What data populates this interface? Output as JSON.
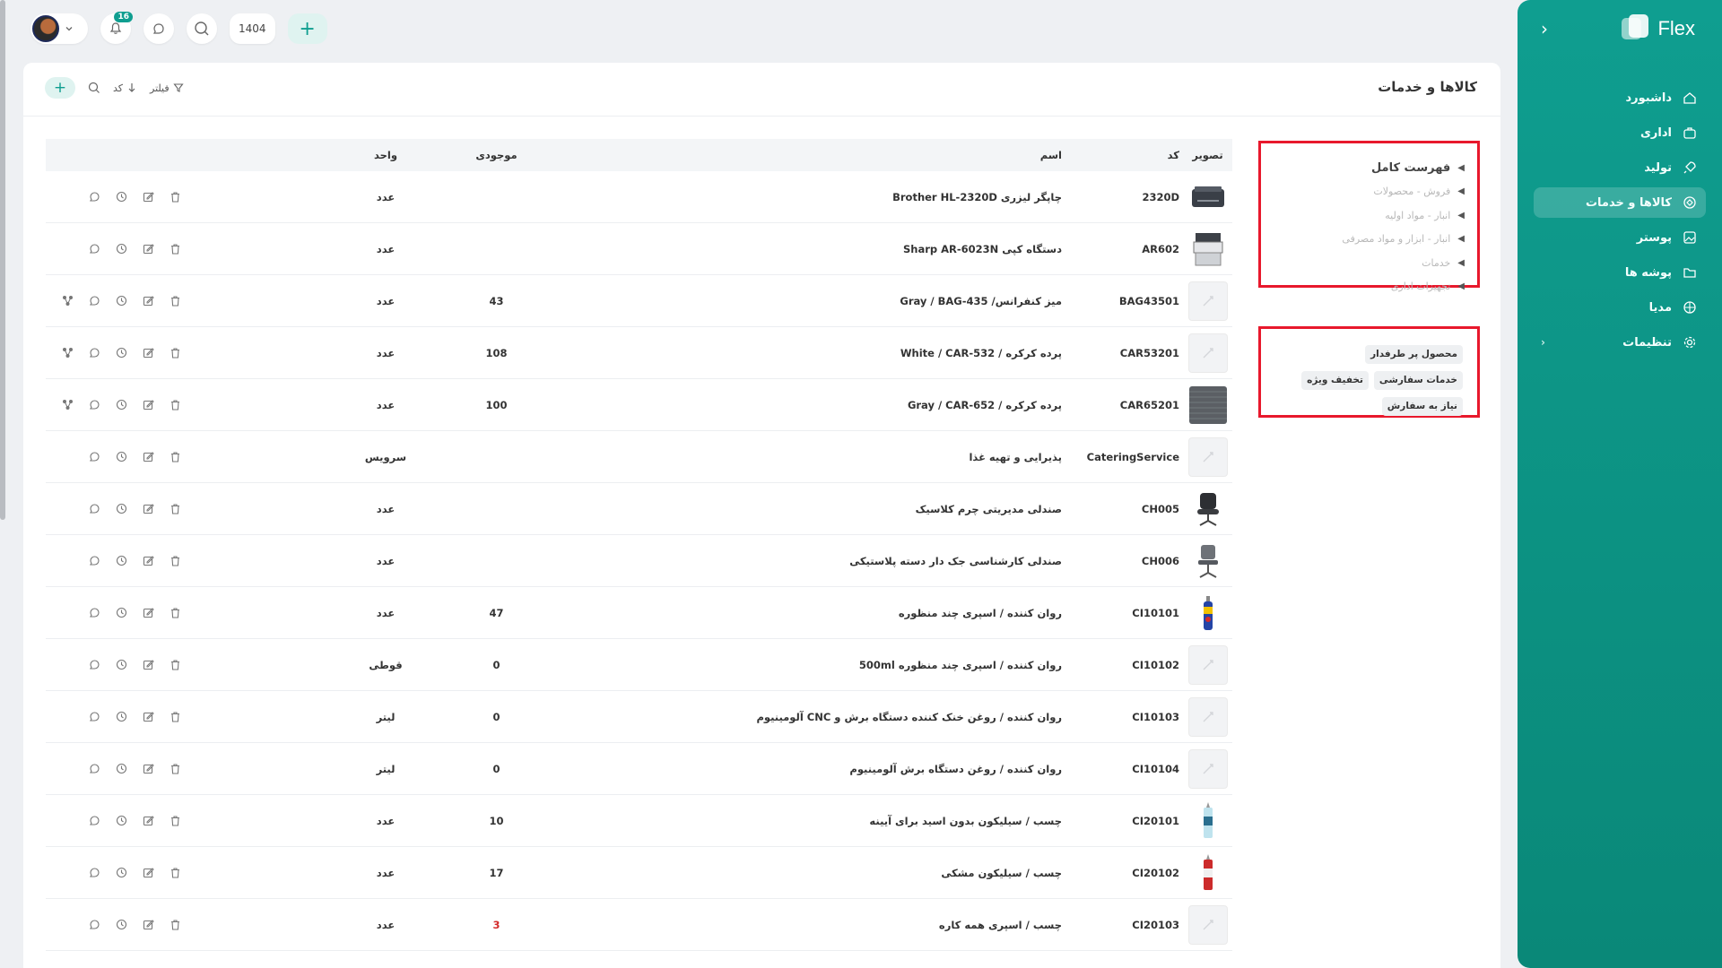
{
  "brand": {
    "name": "Flex"
  },
  "topbar": {
    "notifications_count": "16",
    "year": "1404"
  },
  "sidebar": {
    "items": [
      {
        "label": "داشبورد",
        "icon": "home-icon",
        "active": false
      },
      {
        "label": "اداری",
        "icon": "briefcase-icon",
        "active": false
      },
      {
        "label": "تولید",
        "icon": "rocket-icon",
        "active": false
      },
      {
        "label": "کالاها و خدمات",
        "icon": "box-icon",
        "active": true
      },
      {
        "label": "پوستر",
        "icon": "image-icon",
        "active": false
      },
      {
        "label": "پوشه ها",
        "icon": "folder-icon",
        "active": false
      },
      {
        "label": "مدیا",
        "icon": "media-icon",
        "active": false
      },
      {
        "label": "تنظیمات",
        "icon": "gear-icon",
        "active": false
      }
    ]
  },
  "page": {
    "title": "کالاها و خدمات",
    "tools": {
      "filter": "فیلتر",
      "sort": "کد"
    }
  },
  "categories": [
    "فهرست کامل",
    "فروش - محصولات",
    "انبار - مواد اولیه",
    "انبار - ابزار و مواد مصرفی",
    "خدمات",
    "تجهیزات اداری"
  ],
  "tags": [
    "محصول پر طرفدار",
    "خدمات سفارشی",
    "تخفیف ویژه",
    "نیاز به سفارش"
  ],
  "table": {
    "headers": {
      "image": "تصویر",
      "code": "کد",
      "name": "اسم",
      "stock": "موجودی",
      "unit": "واحد"
    },
    "rows": [
      {
        "code": "2320D",
        "name": "چاپگر لیزری Brother HL-2320D",
        "stock": "",
        "unit": "عدد",
        "thumb": "printer",
        "variants": false
      },
      {
        "code": "AR602",
        "name": "دستگاه کپی Sharp AR-6023N",
        "stock": "",
        "unit": "عدد",
        "thumb": "copier",
        "variants": false
      },
      {
        "code": "BAG43501",
        "name": "میز کنفرانس/ Gray / BAG-435",
        "stock": "43",
        "unit": "عدد",
        "thumb": "placeholder",
        "variants": true
      },
      {
        "code": "CAR53201",
        "name": "پرده کرکره / White / CAR-532",
        "stock": "108",
        "unit": "عدد",
        "thumb": "placeholder",
        "variants": true
      },
      {
        "code": "CAR65201",
        "name": "پرده کرکره / Gray / CAR-652",
        "stock": "100",
        "unit": "عدد",
        "thumb": "fabric",
        "variants": true
      },
      {
        "code": "CateringService",
        "name": "پذیرایی و تهیه غذا",
        "stock": "",
        "unit": "سرویس",
        "thumb": "placeholder",
        "variants": false
      },
      {
        "code": "CH005",
        "name": "صندلی مدیریتی چرم کلاسیک",
        "stock": "",
        "unit": "عدد",
        "thumb": "chair-dark",
        "variants": false
      },
      {
        "code": "CH006",
        "name": "صندلی کارشناسی جک دار دسته پلاستیکی",
        "stock": "",
        "unit": "عدد",
        "thumb": "chair-grey",
        "variants": false
      },
      {
        "code": "CI10101",
        "name": "روان کننده / اسپری چند منظوره",
        "stock": "47",
        "unit": "عدد",
        "thumb": "spray",
        "variants": false
      },
      {
        "code": "CI10102",
        "name": "روان کننده / اسپری چند منظوره 500ml",
        "stock": "0",
        "unit": "قوطی",
        "thumb": "placeholder",
        "variants": false
      },
      {
        "code": "CI10103",
        "name": "روان کننده / روغن خنک کننده دستگاه برش و CNC آلومینیوم",
        "stock": "0",
        "unit": "لیتر",
        "thumb": "placeholder",
        "variants": false
      },
      {
        "code": "CI10104",
        "name": "روان کننده / روغن دستگاه برش آلومینیوم",
        "stock": "0",
        "unit": "لیتر",
        "thumb": "placeholder",
        "variants": false
      },
      {
        "code": "CI20101",
        "name": "چسب / سیلیکون بدون اسید برای آیینه",
        "stock": "10",
        "unit": "عدد",
        "thumb": "tube-blue",
        "variants": false
      },
      {
        "code": "CI20102",
        "name": "چسب / سیلیکون مشکی",
        "stock": "17",
        "unit": "عدد",
        "thumb": "tube-red",
        "variants": false
      },
      {
        "code": "CI20103",
        "name": "چسب / اسپری همه کاره",
        "stock": "3",
        "unit": "عدد",
        "thumb": "placeholder",
        "variants": false,
        "low_stock": true
      }
    ]
  },
  "colors": {
    "accent": "#0f9e90",
    "highlight_border": "#e8182c",
    "low_stock": "#d32b2b"
  }
}
